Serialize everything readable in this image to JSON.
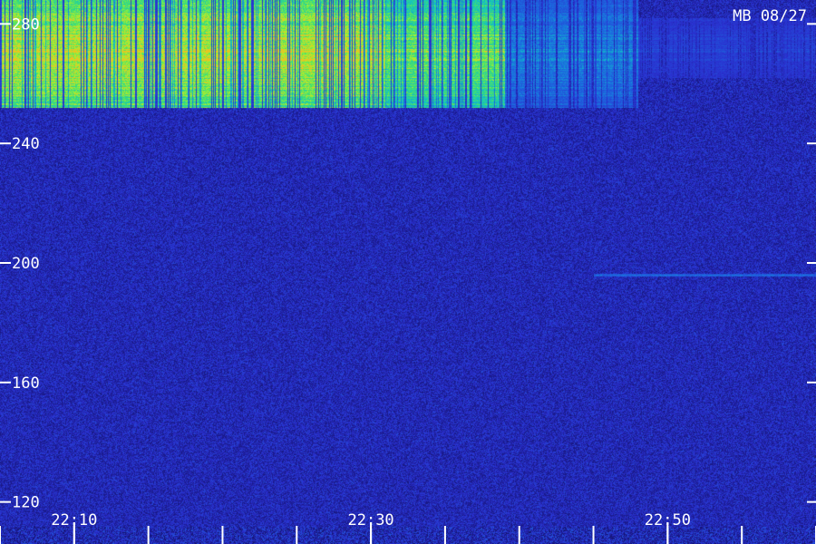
{
  "header": {
    "station_label": "MB 08/27"
  },
  "chart_data": {
    "type": "heatmap",
    "title": "",
    "xlabel": "",
    "ylabel": "",
    "x_ticks": [
      "22:10",
      "22:30",
      "22:50"
    ],
    "x_minor_ticks": [
      "22:05",
      "22:10",
      "22:15",
      "22:20",
      "22:25",
      "22:30",
      "22:35",
      "22:40",
      "22:45",
      "22:50",
      "22:55",
      "23:00"
    ],
    "x_range": [
      "22:05",
      "23:00"
    ],
    "y_ticks": [
      280,
      240,
      200,
      160,
      120
    ],
    "y_range": [
      112,
      288
    ],
    "grid": false,
    "legend": "none",
    "colormap": [
      "#0a0a3a",
      "#1a1a8c",
      "#2a30d0",
      "#1a70e0",
      "#10c0c8",
      "#40e070",
      "#a8f030",
      "#f0c020"
    ],
    "features": [
      {
        "kind": "strong_band",
        "time_start": "22:05",
        "time_end": "22:31",
        "freq_low": 252,
        "freq_high": 288,
        "intensity": 0.85
      },
      {
        "kind": "strong_band",
        "time_start": "22:31",
        "time_end": "22:39",
        "freq_low": 252,
        "freq_high": 288,
        "intensity": 0.7
      },
      {
        "kind": "weak_band",
        "time_start": "22:39",
        "time_end": "22:48",
        "freq_low": 252,
        "freq_high": 288,
        "intensity": 0.35
      },
      {
        "kind": "faint_band",
        "time_start": "22:48",
        "time_end": "23:00",
        "freq_low": 262,
        "freq_high": 282,
        "intensity": 0.2
      },
      {
        "kind": "narrow_line",
        "time_start": "22:45",
        "time_end": "23:00",
        "freq_center": 196,
        "intensity": 0.3
      }
    ]
  }
}
